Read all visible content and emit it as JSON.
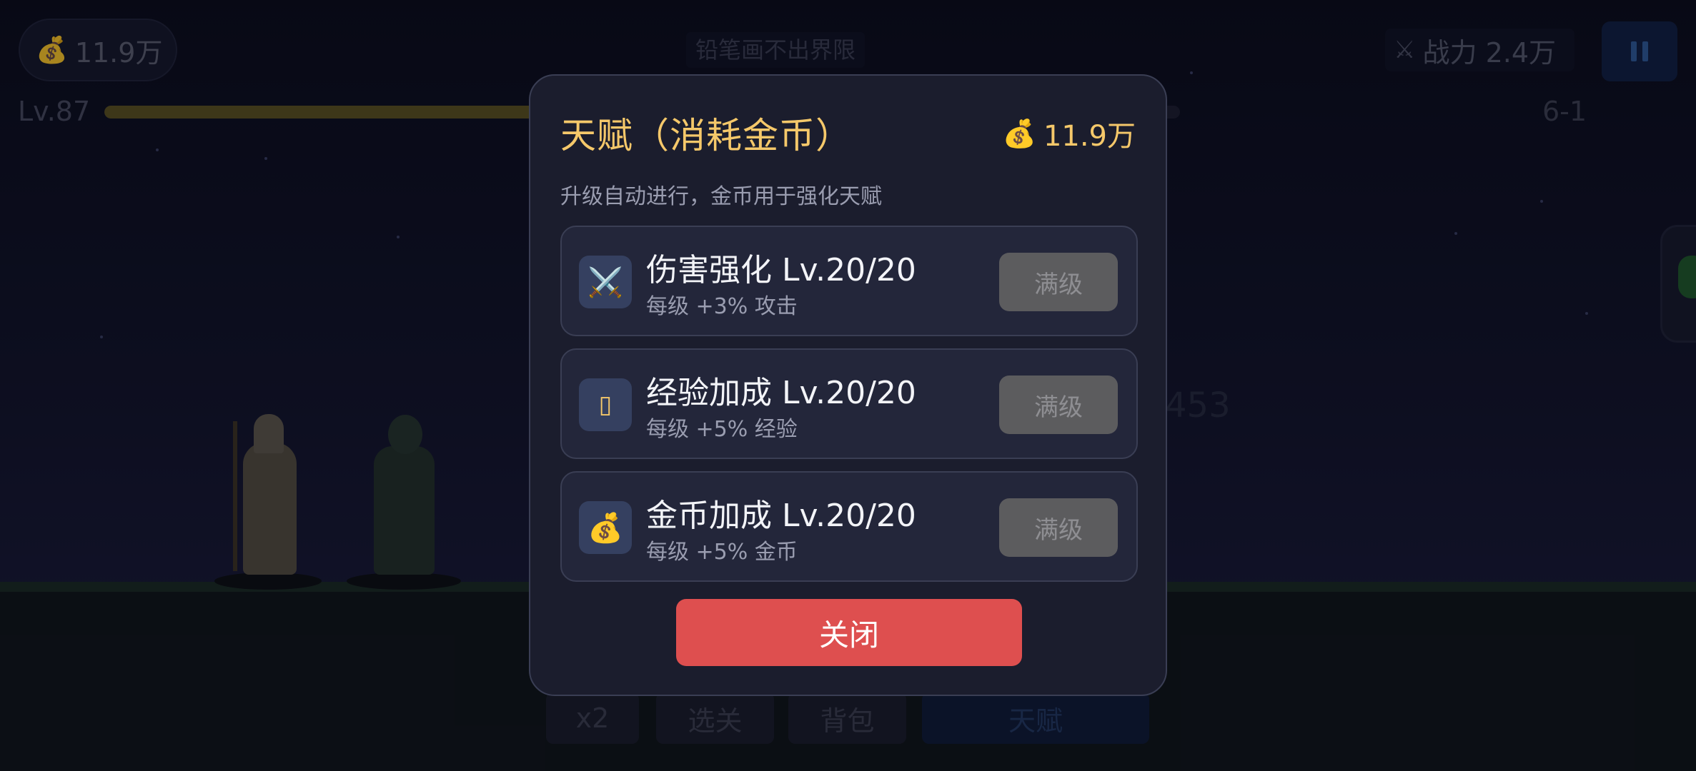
{
  "hud": {
    "coins": "11.9万",
    "coin_icon": "money-bag-icon",
    "stage_title": "铅笔画不出界限",
    "power": "战力 2.4万",
    "level": "Lv.87",
    "xp_progress": 0.66,
    "stage_number": "6-1",
    "floating_number": "453"
  },
  "bottom_bar": {
    "speed": "x2",
    "select_stage": "选关",
    "bag": "背包",
    "talent": "天赋"
  },
  "modal": {
    "title": "天赋（消耗金币）",
    "coins": "11.9万",
    "subtitle": "升级自动进行，金币用于强化天赋",
    "talents": [
      {
        "icon": "crossed-swords-icon",
        "name": "伤害强化  Lv.20/20",
        "desc": "每级 +3% 攻击",
        "button": "满级"
      },
      {
        "icon": "missing-glyph-icon",
        "name": "经验加成  Lv.20/20",
        "desc": "每级 +5% 经验",
        "button": "满级"
      },
      {
        "icon": "money-bag-icon",
        "name": "金币加成  Lv.20/20",
        "desc": "每级 +5% 金币",
        "button": "满级"
      }
    ],
    "close_label": "关闭"
  },
  "colors": {
    "accent_gold": "#f5c86a",
    "close_red": "#de4f4f",
    "max_button_gray": "#5c5c5e",
    "modal_bg": "#1b1d2d"
  }
}
